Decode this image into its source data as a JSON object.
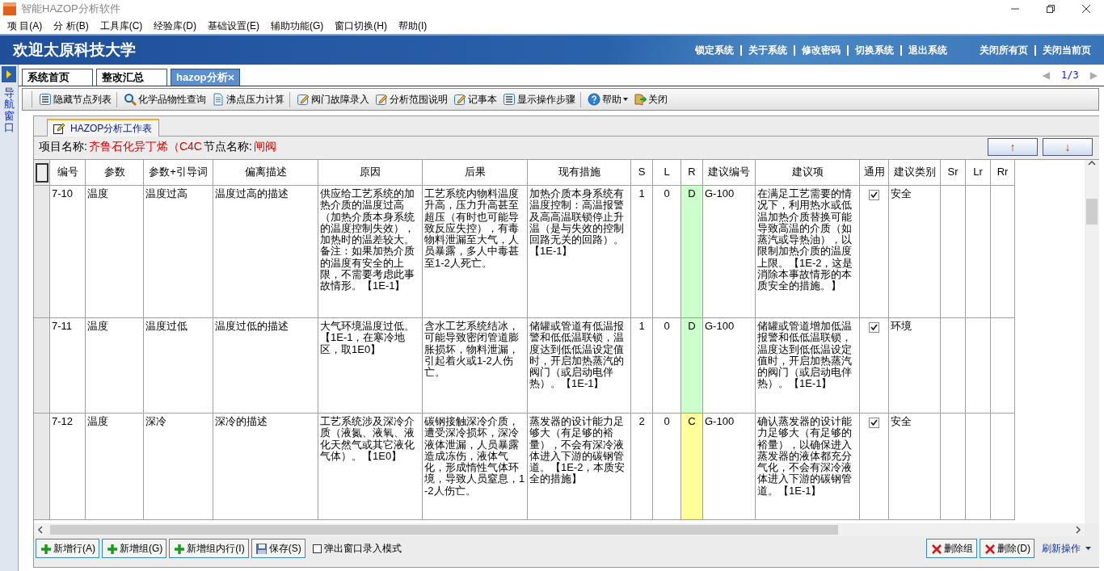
{
  "window": {
    "title": "智能HAZOP分析软件"
  },
  "menu": [
    "项 目(A)",
    "分 析(B)",
    "工具库(C)",
    "经验库(D)",
    "基础设置(E)",
    "辅助功能(G)",
    "窗口切换(H)",
    "帮助(I)"
  ],
  "banner": {
    "title": "欢迎太原科技大学",
    "links": [
      "锁定系统",
      "关于系统",
      "修改密码",
      "切换系统",
      "退出系统"
    ],
    "page_links": [
      "关闭所有页",
      "关闭当前页"
    ]
  },
  "nav": {
    "label": "导航窗口"
  },
  "tabs": [
    {
      "label": "系统首页",
      "selected": false,
      "closable": false
    },
    {
      "label": "整改汇总",
      "selected": false,
      "closable": false
    },
    {
      "label": "hazop分析",
      "selected": true,
      "closable": true
    }
  ],
  "pager": {
    "prev": "◀",
    "page": "1/3",
    "next": "▶"
  },
  "toolbar": [
    {
      "label": "隐藏节点列表",
      "kind": "list",
      "separator_after": true
    },
    {
      "label": "化学品物性查询",
      "kind": "search",
      "separator_after": false
    },
    {
      "label": "沸点压力计算",
      "kind": "doc",
      "separator_after": true
    },
    {
      "label": "阀门故障录入",
      "kind": "edit",
      "separator_after": false
    },
    {
      "label": "分析范围说明",
      "kind": "edit",
      "separator_after": false
    },
    {
      "label": "记事本",
      "kind": "edit",
      "separator_after": false
    },
    {
      "label": "显示操作步骤",
      "kind": "list",
      "separator_after": true
    },
    {
      "label": "帮助",
      "kind": "help",
      "separator_after": false,
      "dropdown": true
    },
    {
      "label": "关闭",
      "kind": "exit",
      "separator_after": false
    }
  ],
  "worksheet": {
    "tab": "HAZOP分析工作表",
    "project_label": "项目名称:",
    "project": "齐鲁石化异丁烯（C4C",
    "node_label": "节点名称:",
    "node": "闸阀",
    "up": "↑",
    "down": "↓"
  },
  "table": {
    "columns": [
      "编号",
      "参数",
      "参数+引导词",
      "偏离描述",
      "原因",
      "后果",
      "现有措施",
      "S",
      "L",
      "R",
      "建议编号",
      "建议项",
      "通用",
      "建议类别",
      "Sr",
      "Lr",
      "Rr"
    ],
    "rows": [
      {
        "no": "7-10",
        "param": "温度",
        "guide": "温度过高",
        "deviation": "温度过高的描述",
        "cause": "供应给工艺系统的加热介质的温度过高（加热介质本身系统的温度控制失效），加热时的温差较大。备注：如果加热介质的温度有安全的上限，不需要考虑此事故情形。【1E-1】",
        "consequence": "工艺系统内物料温度升高，压力升高甚至超压（有时也可能导致反应失控），有毒物料泄漏至大气，人员暴露，多人中毒甚至1-2人死亡。",
        "measures": "加热介质本身系统有温度控制：高温报警及高高温联锁停止升温（是与失效的控制回路无关的回路）。【1E-1】",
        "s": "1",
        "l": "0",
        "r": {
          "text": "D",
          "color": "#ccffcc"
        },
        "rec_no": "G-100",
        "recommendation": "在满足工艺需要的情况下，利用热水或低温加热介质替换可能导致高温的介质（如蒸汽或导热油），以限制加热介质的温度上限。【1E-2，这是消除本事故情形的本质安全的措施。】",
        "common": true,
        "category": "安全"
      },
      {
        "no": "7-11",
        "param": "温度",
        "guide": "温度过低",
        "deviation": "温度过低的描述",
        "cause": "大气环境温度过低。【1E-1，在寒冷地区，取1E0】",
        "consequence": "含水工艺系统结冰，可能导致密闭管道膨胀损坏，物料泄漏，引起着火或1-2人伤亡。",
        "measures": "储罐或管道有低温报警和低低温联锁，温度达到低低温设定值时，开启加热蒸汽的阀门（或启动电伴热）。【1E-1】",
        "s": "1",
        "l": "0",
        "r": {
          "text": "D",
          "color": "#ccffcc"
        },
        "rec_no": "G-100",
        "recommendation": "储罐或管道增加低温报警和低低温联锁，温度达到低低温设定值时，开启加热蒸汽的阀门（或启动电伴热）。【1E-1】",
        "common": true,
        "category": "环境"
      },
      {
        "no": "7-12",
        "param": "温度",
        "guide": "深冷",
        "deviation": "深冷的描述",
        "cause": "工艺系统涉及深冷介质（液氮、液氧、液化天然气或其它液化气体）。【1E0】",
        "consequence": "碳钢接触深冷介质，遭受深冷损坏，深冷液体泄漏，人员暴露造成冻伤，液体气化，形成惰性气体环境，导致人员窒息，1-2人伤亡。",
        "measures": "蒸发器的设计能力足够大（有足够的裕量），不会有深冷液体进入下游的碳钢管道。【1E-2，本质安全的措施】",
        "s": "2",
        "l": "0",
        "r": {
          "text": "C",
          "color": "#ffff99"
        },
        "rec_no": "G-100",
        "recommendation": "确认蒸发器的设计能力足够大（有足够的裕量），以确保进入蒸发器的液体都充分气化，不会有深冷液体进入下游的碳钢管道。【1E-1】",
        "common": true,
        "category": "安全"
      }
    ]
  },
  "footer": {
    "buttons": [
      {
        "label": "新增行(A)",
        "kind": "plus"
      },
      {
        "label": "新增组(G)",
        "kind": "plus"
      },
      {
        "label": "新增组内行(I)",
        "kind": "plus"
      },
      {
        "label": "保存(S)",
        "kind": "save"
      }
    ],
    "popup_mode": {
      "label": "弹出窗口录入模式",
      "checked": false
    },
    "right_buttons": [
      {
        "label": "删除组",
        "kind": "x"
      },
      {
        "label": "删除(D)",
        "kind": "x"
      }
    ],
    "refresh": {
      "label": "刷新操作",
      "dropdown": true
    }
  }
}
